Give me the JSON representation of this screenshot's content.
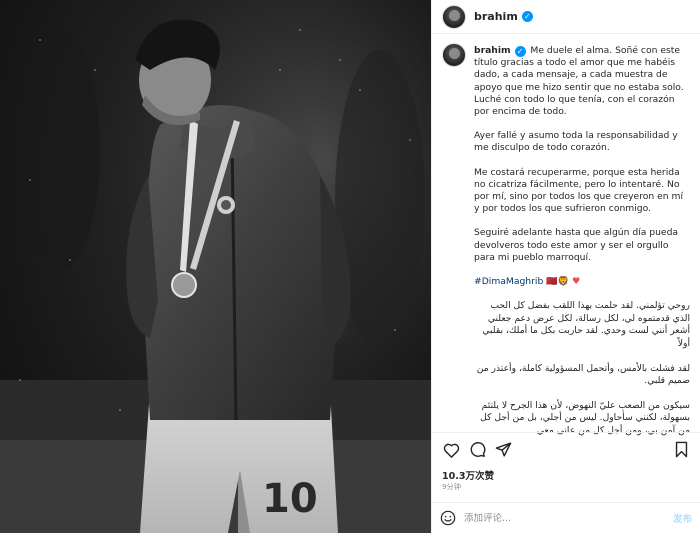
{
  "post": {
    "username": "brahim",
    "verified_glyph": "✓",
    "photo_jersey_number": "10"
  },
  "caption": {
    "username": "brahim",
    "es_p1": "Me duele el alma. Soñé con este título gracias a todo el amor que me habéis dado, a cada mensaje, a cada muestra de apoyo que me hizo sentir que no estaba solo. Luché con todo lo que tenía, con el corazón por encima de todo.",
    "es_p2": "Ayer fallé y asumo toda la responsabilidad y me disculpo de todo corazón.",
    "es_p3": "Me costará recuperarme, porque esta herida no cicatriza fácilmente, pero lo intentaré. No por mí, sino por todos los que creyeron en mí y por todos los que sufrieron conmigo.",
    "es_p4": "Seguiré adelante hasta que algún día pueda devolveros todo este amor y ser el orgullo para mi pueblo marroquí.",
    "hashtag": "#DimaMaghrib",
    "emoji_text": "🇲🇦🦁",
    "heart": "♥",
    "ar_p1": "روحي تؤلمني. لقد حلمت بهذا اللقب بفضل كل الحب الذي قدمتموه لي، لكل رسالة، لكل عرض دعم جعلني أشعر أنني لست وحدي. لقد حاربت بكل ما أملك، بقلبي أولاً",
    "ar_p2": "لقد فشلت بالأمس، وأتحمل المسؤولية كاملة، وأعتذر من صميم قلبي.",
    "ar_p3": "سيكون من الصعب عليّ النهوض، لأن هذا الجرح لا يلتئم بسهولة، لكنني سأحاول. ليس من أجلي، بل من أجل كل من آمن بي، ومن أجل كل من عانى معي"
  },
  "stats": {
    "likes": "10.3万次赞",
    "time_ago": "9分钟"
  },
  "comment": {
    "placeholder": "添加评论...",
    "post_label": "发布"
  },
  "icons": {
    "like": "heart-icon",
    "comment": "speech-bubble-icon",
    "share": "paper-plane-icon",
    "save": "bookmark-icon",
    "emoji": "smiley-icon"
  },
  "colors": {
    "verified": "#0095f6",
    "hashtag": "#00376b",
    "heart": "#ed4956",
    "post_button": "#b2dffc",
    "muted": "#8e8e8e"
  }
}
